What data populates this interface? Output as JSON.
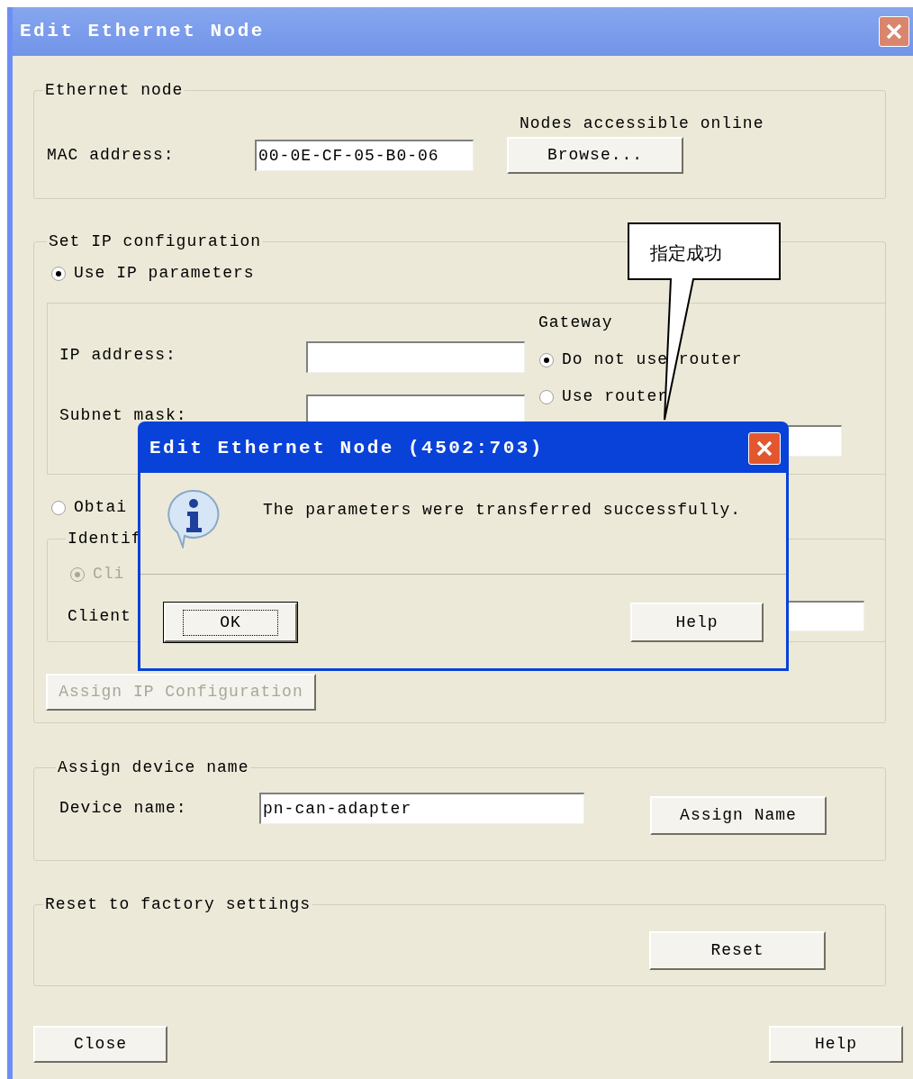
{
  "window": {
    "title": "Edit Ethernet Node"
  },
  "ethernet_node": {
    "legend": "Ethernet node",
    "online_label": "Nodes accessible online",
    "mac_label": "MAC address:",
    "mac_value": "00-0E-CF-05-B0-06",
    "browse_button": "Browse..."
  },
  "ip_config": {
    "legend": "Set IP configuration",
    "options": [
      {
        "label": "Use IP parameters",
        "selected": true
      },
      {
        "label": "Obtai",
        "selected": false
      }
    ],
    "ip_label": "IP address:",
    "subnet_label": "Subnet mask:",
    "gateway_label": "Gateway",
    "gateway_options": [
      {
        "label": "Do not use router",
        "selected": true
      },
      {
        "label": "Use router",
        "selected": false
      }
    ],
    "identify": {
      "legend": "Identif",
      "option": {
        "label": "Cli",
        "selected": true,
        "disabled": true
      },
      "client_label": "Client"
    },
    "assign_button": {
      "label": "Assign IP Configuration",
      "disabled": true
    }
  },
  "device_name": {
    "legend": "Assign device name",
    "label": "Device name:",
    "value": "pn-can-adapter",
    "button": "Assign Name"
  },
  "reset": {
    "legend": "Reset to factory settings",
    "button": "Reset"
  },
  "footer": {
    "close_button": "Close",
    "help_button": "Help"
  },
  "message_dialog": {
    "title": "Edit Ethernet Node (4502:703)",
    "message": "The parameters were transferred successfully.",
    "buttons": [
      {
        "label": "OK",
        "focused": true
      },
      {
        "label": "Help",
        "focused": false
      }
    ]
  },
  "callout": {
    "text": "指定成功"
  }
}
